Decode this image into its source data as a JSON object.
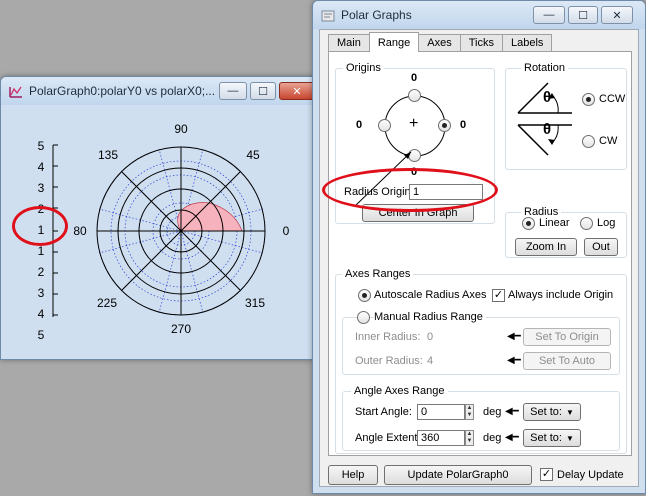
{
  "graph_window": {
    "title": "PolarGraph0:polarY0 vs polarX0;...",
    "angle_labels": [
      "90",
      "45",
      "0",
      "315",
      "270",
      "225",
      "80",
      "135"
    ],
    "radius_axis_labels": [
      "5",
      "4",
      "3",
      "2",
      "1",
      "1",
      "2",
      "3",
      "4",
      "5"
    ],
    "colors": {
      "fill": "#f7b3bd",
      "grid_dotted": "#2a3fd6"
    }
  },
  "dialog": {
    "title": "Polar Graphs",
    "tabs": [
      "Main",
      "Range",
      "Axes",
      "Ticks",
      "Labels"
    ],
    "active_tab": "Range",
    "origins": {
      "label": "Origins",
      "top_value": "0",
      "left_value": "0",
      "right_value": "0",
      "bottom_value": "0",
      "center_symbol": "+",
      "radius_origin_label": "Radius Origin",
      "radius_origin_value": "1",
      "center_button": "Center In Graph"
    },
    "rotation": {
      "label": "Rotation",
      "symbol": "θ",
      "ccw_label": "CCW",
      "cw_label": "CW"
    },
    "radius": {
      "label": "Radius",
      "linear_label": "Linear",
      "log_label": "Log",
      "zoom_in": "Zoom In",
      "out": "Out"
    },
    "axes_ranges": {
      "label": "Axes Ranges",
      "autoscale_label": "Autoscale Radius Axes",
      "always_include_label": "Always include Origin",
      "manual_label": "Manual Radius Range",
      "inner_label": "Inner Radius:",
      "inner_value": "0",
      "outer_label": "Outer Radius:",
      "outer_value": "4",
      "set_to_origin": "Set To Origin",
      "set_to_auto": "Set To Auto"
    },
    "angle_axes_range": {
      "label": "Angle Axes Range",
      "start_label": "Start Angle:",
      "start_value": "0",
      "extent_label": "Angle Extent:",
      "extent_value": "360",
      "deg": "deg",
      "set_to": "Set to:"
    },
    "footer": {
      "help": "Help",
      "update": "Update PolarGraph0",
      "delay_update": "Delay Update"
    },
    "check_symbol": "✓",
    "dropdown_symbol": "▼"
  },
  "annotation_color": "#e0101b"
}
